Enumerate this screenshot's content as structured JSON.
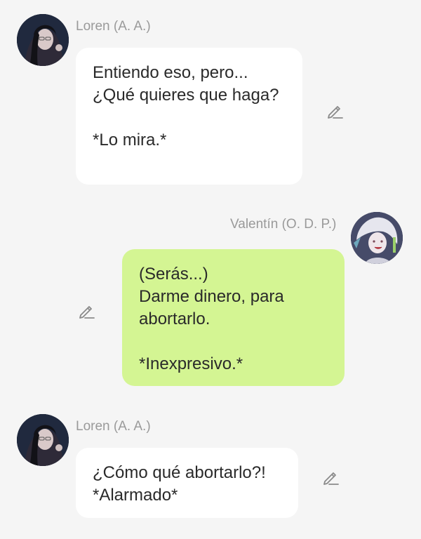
{
  "messages": [
    {
      "sender": "Loren (A. A.)",
      "side": "left",
      "text": "Entiendo eso, pero...\n¿Qué quieres que haga?\n\n*Lo mira.*",
      "avatar_icon": "character-avatar"
    },
    {
      "sender": "Valentín (O. D. P.)",
      "side": "right",
      "text": "(Serás...)\nDarme dinero, para abortarlo.\n\n*Inexpresivo.*",
      "avatar_icon": "character-avatar"
    },
    {
      "sender": "Loren (A. A.)",
      "side": "left",
      "text": "¿Cómo qué abortarlo?!\n*Alarmado*",
      "avatar_icon": "character-avatar"
    }
  ],
  "colors": {
    "background": "#f5f5f5",
    "incoming_bubble": "#ffffff",
    "outgoing_bubble": "#d4f593",
    "name_text": "#9a9a9a",
    "message_text": "#2a2a2a",
    "edit_icon": "#8a8a8a"
  },
  "icons": {
    "edit": "pencil-icon"
  }
}
